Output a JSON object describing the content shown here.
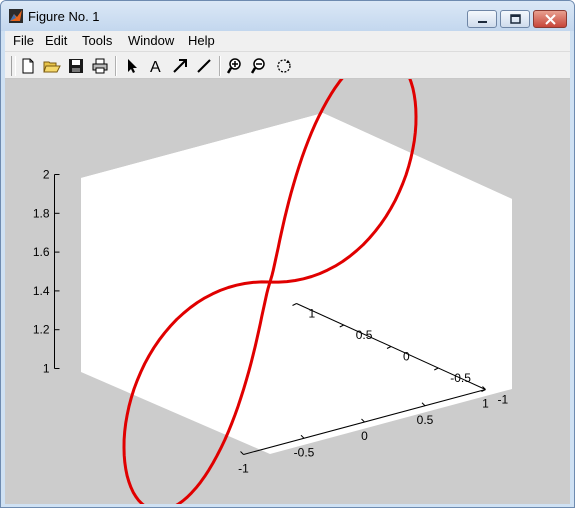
{
  "window": {
    "title": "Figure No. 1",
    "accent_color": "#c3d7ee"
  },
  "menubar": {
    "items": [
      {
        "label": "File"
      },
      {
        "label": "Edit"
      },
      {
        "label": "Tools"
      },
      {
        "label": "Window"
      },
      {
        "label": "Help"
      }
    ]
  },
  "toolbar": {
    "buttons": [
      {
        "icon": "new-figure-icon"
      },
      {
        "icon": "open-file-icon"
      },
      {
        "icon": "save-icon"
      },
      {
        "icon": "print-icon"
      },
      {
        "icon": "edit-plot-arrow-icon"
      },
      {
        "icon": "insert-text-icon"
      },
      {
        "icon": "insert-arrow-icon"
      },
      {
        "icon": "insert-line-icon"
      },
      {
        "icon": "zoom-in-icon"
      },
      {
        "icon": "zoom-out-icon"
      },
      {
        "icon": "rotate-3d-icon"
      }
    ]
  },
  "chart_data": {
    "type": "line",
    "projection": "3d",
    "curve_color": "#e00000",
    "description_free": true,
    "series": [
      {
        "x": [
          0,
          0.31,
          0.59,
          0.81,
          0.95,
          1.0,
          0.95,
          0.81,
          0.59,
          0.31,
          0,
          -0.31,
          -0.59,
          -0.81,
          -0.95,
          -1.0,
          -0.95,
          -0.81,
          -0.59,
          -0.31,
          0
        ],
        "y": [
          0,
          0.29,
          0.48,
          0.48,
          0.29,
          0,
          -0.29,
          -0.48,
          -0.48,
          -0.29,
          0,
          0.29,
          0.48,
          0.48,
          0.29,
          0,
          -0.29,
          -0.48,
          -0.48,
          -0.29,
          0
        ],
        "z": [
          1.5,
          1.55,
          1.68,
          1.85,
          1.97,
          2.0,
          1.97,
          1.85,
          1.68,
          1.55,
          1.5,
          1.45,
          1.32,
          1.15,
          1.03,
          1.0,
          1.03,
          1.15,
          1.32,
          1.45,
          1.5
        ]
      }
    ],
    "xlim": [
      -1,
      1
    ],
    "ylim": [
      -1,
      1
    ],
    "zlim": [
      1,
      2
    ],
    "x_ticks": [
      "-1",
      "-0.5",
      "0",
      "0.5",
      "1"
    ],
    "y_ticks": [
      "-1",
      "-0.5",
      "0",
      "0.5",
      "1"
    ],
    "z_ticks": [
      "1",
      "1.2",
      "1.4",
      "1.6",
      "1.8",
      "2"
    ],
    "grid": false
  }
}
